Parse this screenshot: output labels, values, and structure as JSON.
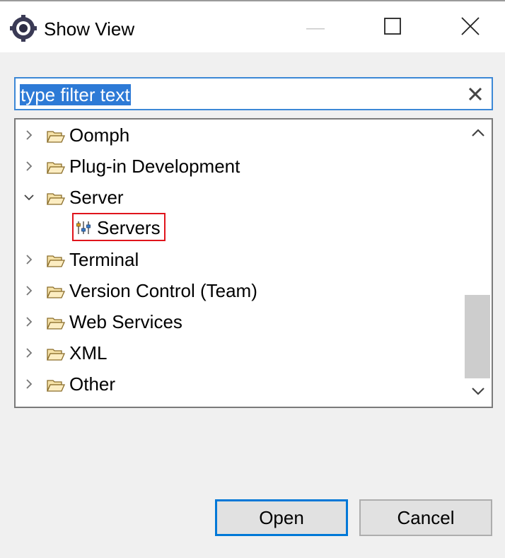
{
  "window": {
    "title": "Show View",
    "app_icon": "eclipse-gear-icon",
    "controls": [
      "minimize-icon",
      "maximize-icon",
      "close-icon"
    ]
  },
  "filter": {
    "value": "type filter text",
    "selected": true,
    "clear_icon": "clear-x-icon"
  },
  "tree": {
    "items": [
      {
        "label": "Oomph",
        "expanded": false,
        "icon": "folder-icon"
      },
      {
        "label": "Plug-in Development",
        "expanded": false,
        "icon": "folder-icon"
      },
      {
        "label": "Server",
        "expanded": true,
        "icon": "folder-icon"
      },
      {
        "label": "Terminal",
        "expanded": false,
        "icon": "folder-icon"
      },
      {
        "label": "Version Control (Team)",
        "expanded": false,
        "icon": "folder-icon"
      },
      {
        "label": "Web Services",
        "expanded": false,
        "icon": "folder-icon"
      },
      {
        "label": "XML",
        "expanded": false,
        "icon": "folder-icon"
      },
      {
        "label": "Other",
        "expanded": false,
        "icon": "folder-icon"
      }
    ],
    "server_child": {
      "label": "Servers",
      "icon": "servers-view-icon",
      "highlighted": true
    }
  },
  "buttons": {
    "open_label": "Open",
    "cancel_label": "Cancel"
  },
  "colors": {
    "selection": "#2d7ad6",
    "highlight_box": "#e0141c",
    "default_button_border": "#0078d7"
  }
}
